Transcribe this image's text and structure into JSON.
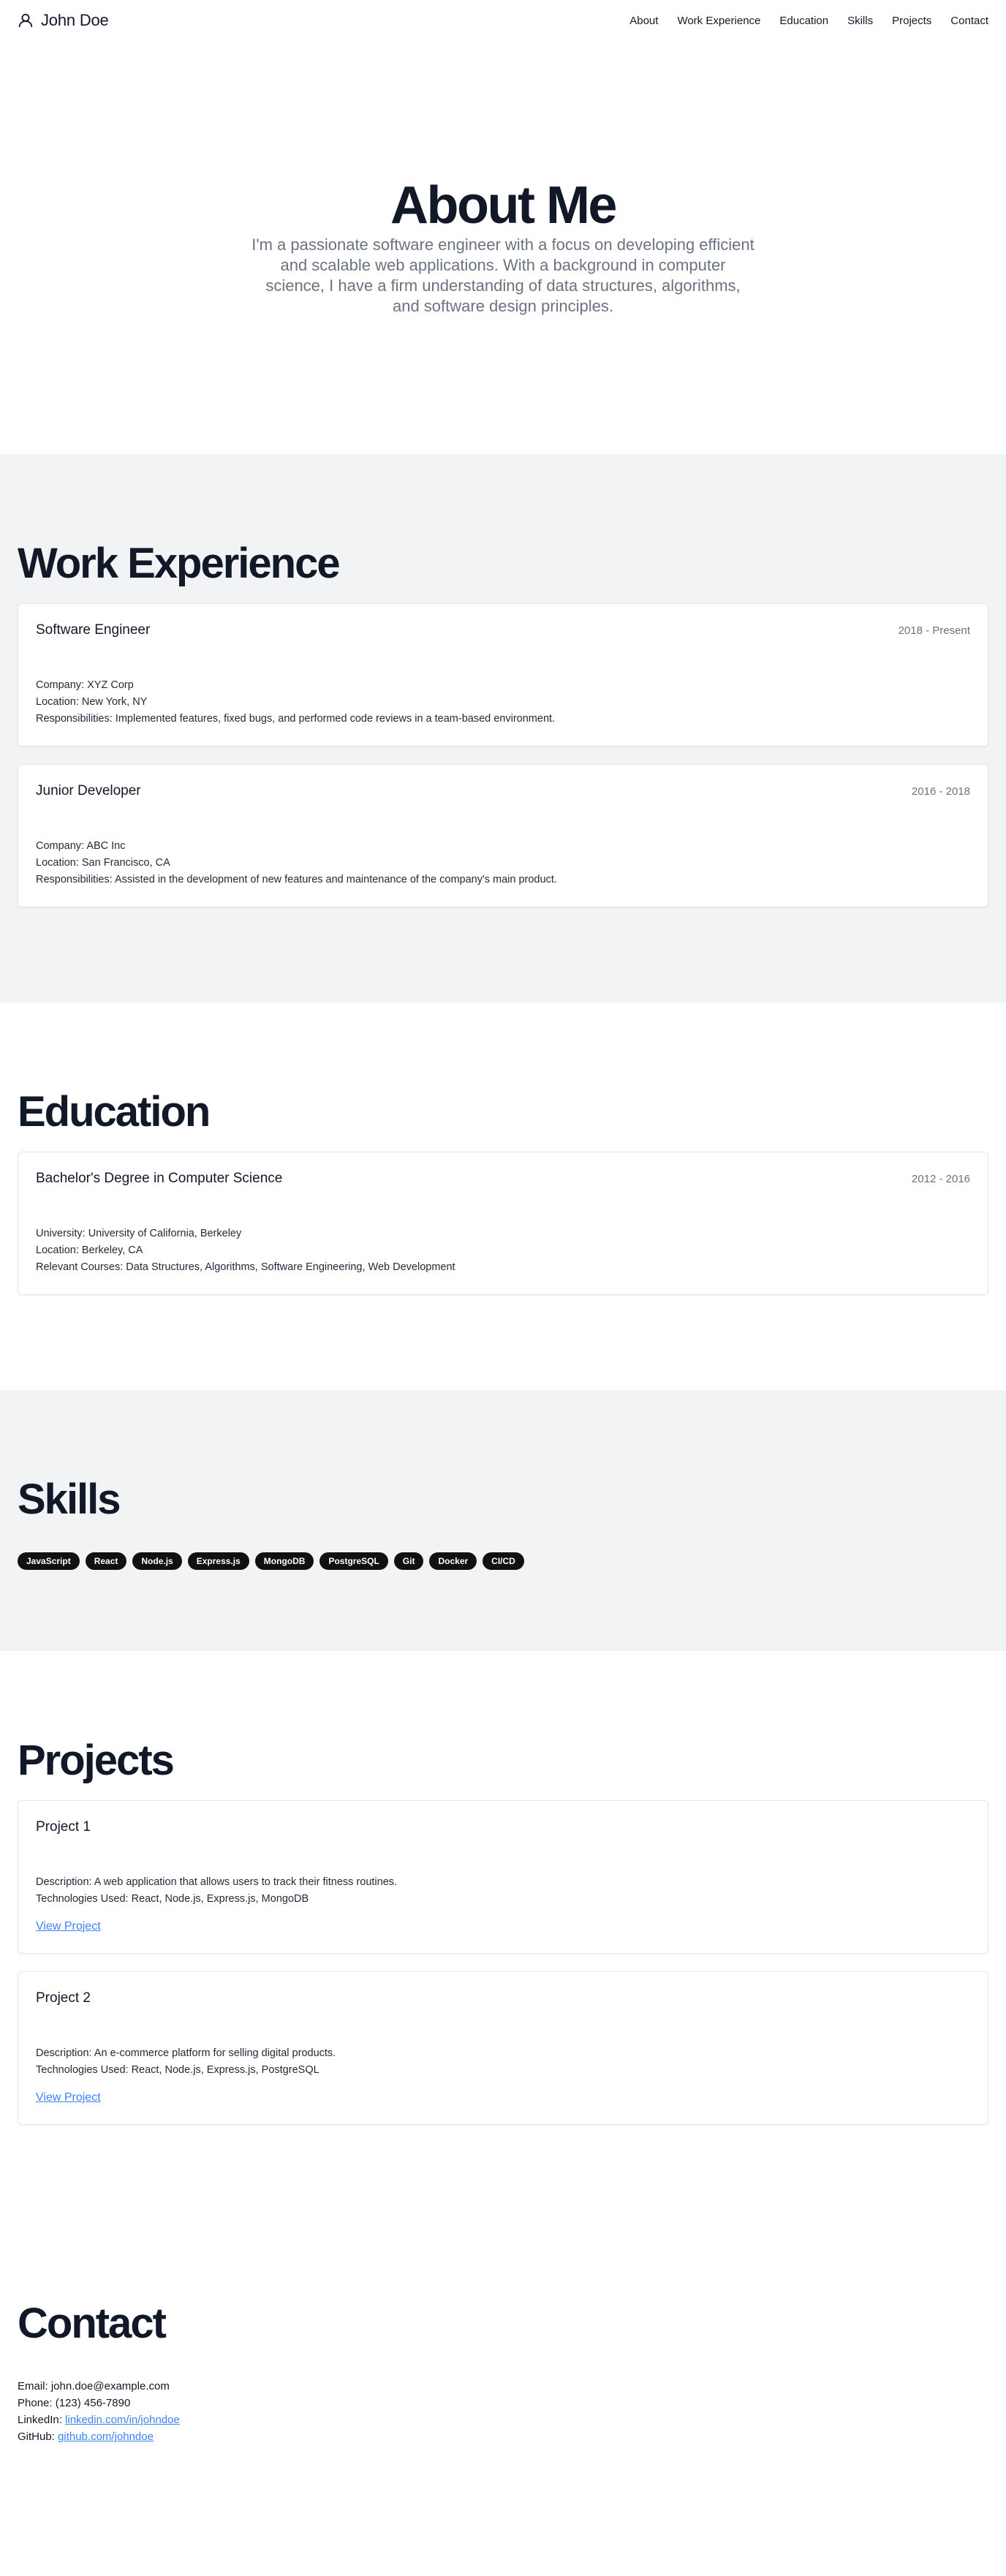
{
  "brand": {
    "name": "John Doe",
    "icon": "user-icon"
  },
  "nav": [
    "About",
    "Work Experience",
    "Education",
    "Skills",
    "Projects",
    "Contact"
  ],
  "hero": {
    "title": "About Me",
    "text": "I'm a passionate software engineer with a focus on developing efficient and scalable web applications. With a background in computer science, I have a firm understanding of data structures, algorithms, and software design principles."
  },
  "experience": {
    "title": "Work Experience",
    "items": [
      {
        "role": "Software Engineer",
        "dates": "2018 - Present",
        "company": "Company: XYZ Corp",
        "location": "Location: New York, NY",
        "responsibilities": "Responsibilities: Implemented features, fixed bugs, and performed code reviews in a team-based environment."
      },
      {
        "role": "Junior Developer",
        "dates": "2016 - 2018",
        "company": "Company: ABC Inc",
        "location": "Location: San Francisco, CA",
        "responsibilities": "Responsibilities: Assisted in the development of new features and maintenance of the company's main product."
      }
    ]
  },
  "education": {
    "title": "Education",
    "items": [
      {
        "degree": "Bachelor's Degree in Computer Science",
        "dates": "2012 - 2016",
        "university": "University: University of California, Berkeley",
        "location": "Location: Berkeley, CA",
        "courses": "Relevant Courses: Data Structures, Algorithms, Software Engineering, Web Development"
      }
    ]
  },
  "skills": {
    "title": "Skills",
    "items": [
      "JavaScript",
      "React",
      "Node.js",
      "Express.js",
      "MongoDB",
      "PostgreSQL",
      "Git",
      "Docker",
      "CI/CD"
    ]
  },
  "projects": {
    "title": "Projects",
    "items": [
      {
        "name": "Project 1",
        "description": "Description: A web application that allows users to track their fitness routines.",
        "tech": "Technologies Used: React, Node.js, Express.js, MongoDB",
        "link": "View Project"
      },
      {
        "name": "Project 2",
        "description": "Description: An e-commerce platform for selling digital products.",
        "tech": "Technologies Used: React, Node.js, Express.js, PostgreSQL",
        "link": "View Project"
      }
    ]
  },
  "contact": {
    "title": "Contact",
    "email": "Email: john.doe@example.com",
    "phone": "Phone: (123) 456-7890",
    "linkedin_label": "LinkedIn: ",
    "linkedin_link": "linkedin.com/in/johndoe",
    "github_label": "GitHub: ",
    "github_link": "github.com/johndoe"
  },
  "colors": {
    "accent": "#3b82f6",
    "muted": "#6b7280",
    "section_bg": "#f2f3f5",
    "badge_bg": "#111111"
  }
}
